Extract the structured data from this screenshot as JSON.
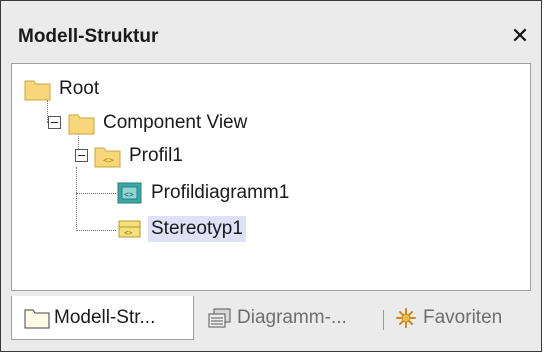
{
  "window": {
    "title": "Modell-Struktur",
    "close_label": "✕"
  },
  "tree": {
    "nodes": [
      {
        "label": "Root",
        "icon": "folder-icon"
      },
      {
        "label": "Component View",
        "icon": "folder-icon",
        "expanded": true
      },
      {
        "label": "Profil1",
        "icon": "profile-package-icon",
        "expanded": true
      },
      {
        "label": "Profildiagramm1",
        "icon": "profile-diagram-icon"
      },
      {
        "label": "Stereotyp1",
        "icon": "stereotype-icon",
        "selected": true
      }
    ]
  },
  "tabs": [
    {
      "label": "Modell-Str...",
      "icon": "folder-icon",
      "active": true
    },
    {
      "label": "Diagramm-...",
      "icon": "diagram-tree-icon",
      "active": false
    },
    {
      "label": "Favoriten",
      "icon": "favorites-star-icon",
      "active": false
    }
  ],
  "colors": {
    "folder": "#f8d77a",
    "selection": "#dfe1f7",
    "diagram_teal": "#3aa7a7",
    "stereotype_yellow": "#f5e07a"
  }
}
